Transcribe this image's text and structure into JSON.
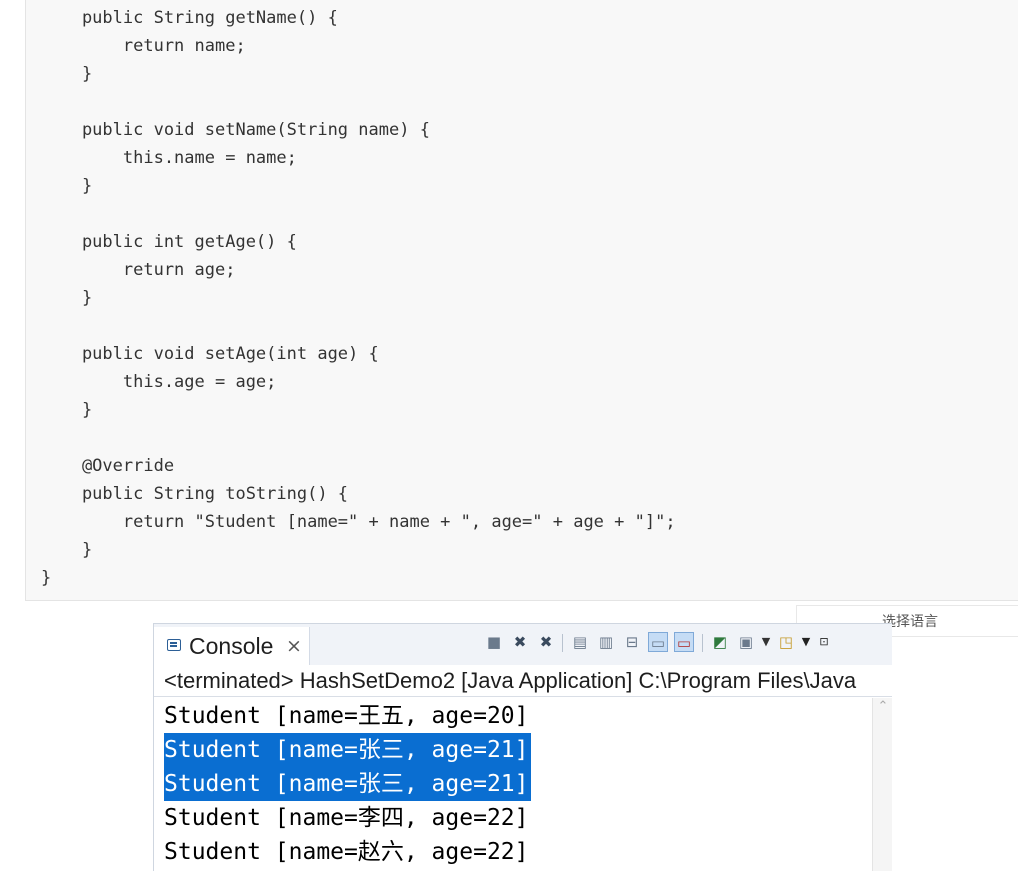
{
  "code": {
    "lines": [
      "    public String getName() {",
      "        return name;",
      "    }",
      "",
      "    public void setName(String name) {",
      "        this.name = name;",
      "    }",
      "",
      "    public int getAge() {",
      "        return age;",
      "    }",
      "",
      "    public void setAge(int age) {",
      "        this.age = age;",
      "    }",
      "",
      "    @Override",
      "    public String toString() {",
      "        return \"Student [name=\" + name + \", age=\" + age + \"]\";",
      "    }",
      "}"
    ]
  },
  "language_select": {
    "label": "选择语言"
  },
  "console": {
    "tab_label": "Console",
    "tab_close": "×",
    "status": "<terminated> HashSetDemo2 [Java Application] C:\\Program Files\\Java",
    "output": [
      {
        "text": "Student [name=王五, age=20]",
        "selected": false
      },
      {
        "text": "Student [name=张三, age=21]",
        "selected": true
      },
      {
        "text": "Student [name=张三, age=21]",
        "selected": true
      },
      {
        "text": "Student [name=李四, age=22]",
        "selected": false
      },
      {
        "text": "Student [name=赵六, age=22]",
        "selected": false
      }
    ],
    "toolbar_icons": [
      "terminate-icon",
      "remove-launch-icon",
      "remove-all-terminated-icon",
      "clear-console-icon",
      "scroll-lock-icon",
      "word-wrap-icon",
      "show-console-on-stdout-icon",
      "show-console-on-stderr-icon",
      "pin-console-icon",
      "display-selected-console-icon",
      "open-console-icon",
      "view-menu-icon",
      "minimize-icon"
    ]
  },
  "colors": {
    "selection": "#0a6ed1",
    "code_bg": "#f8f8f8"
  }
}
